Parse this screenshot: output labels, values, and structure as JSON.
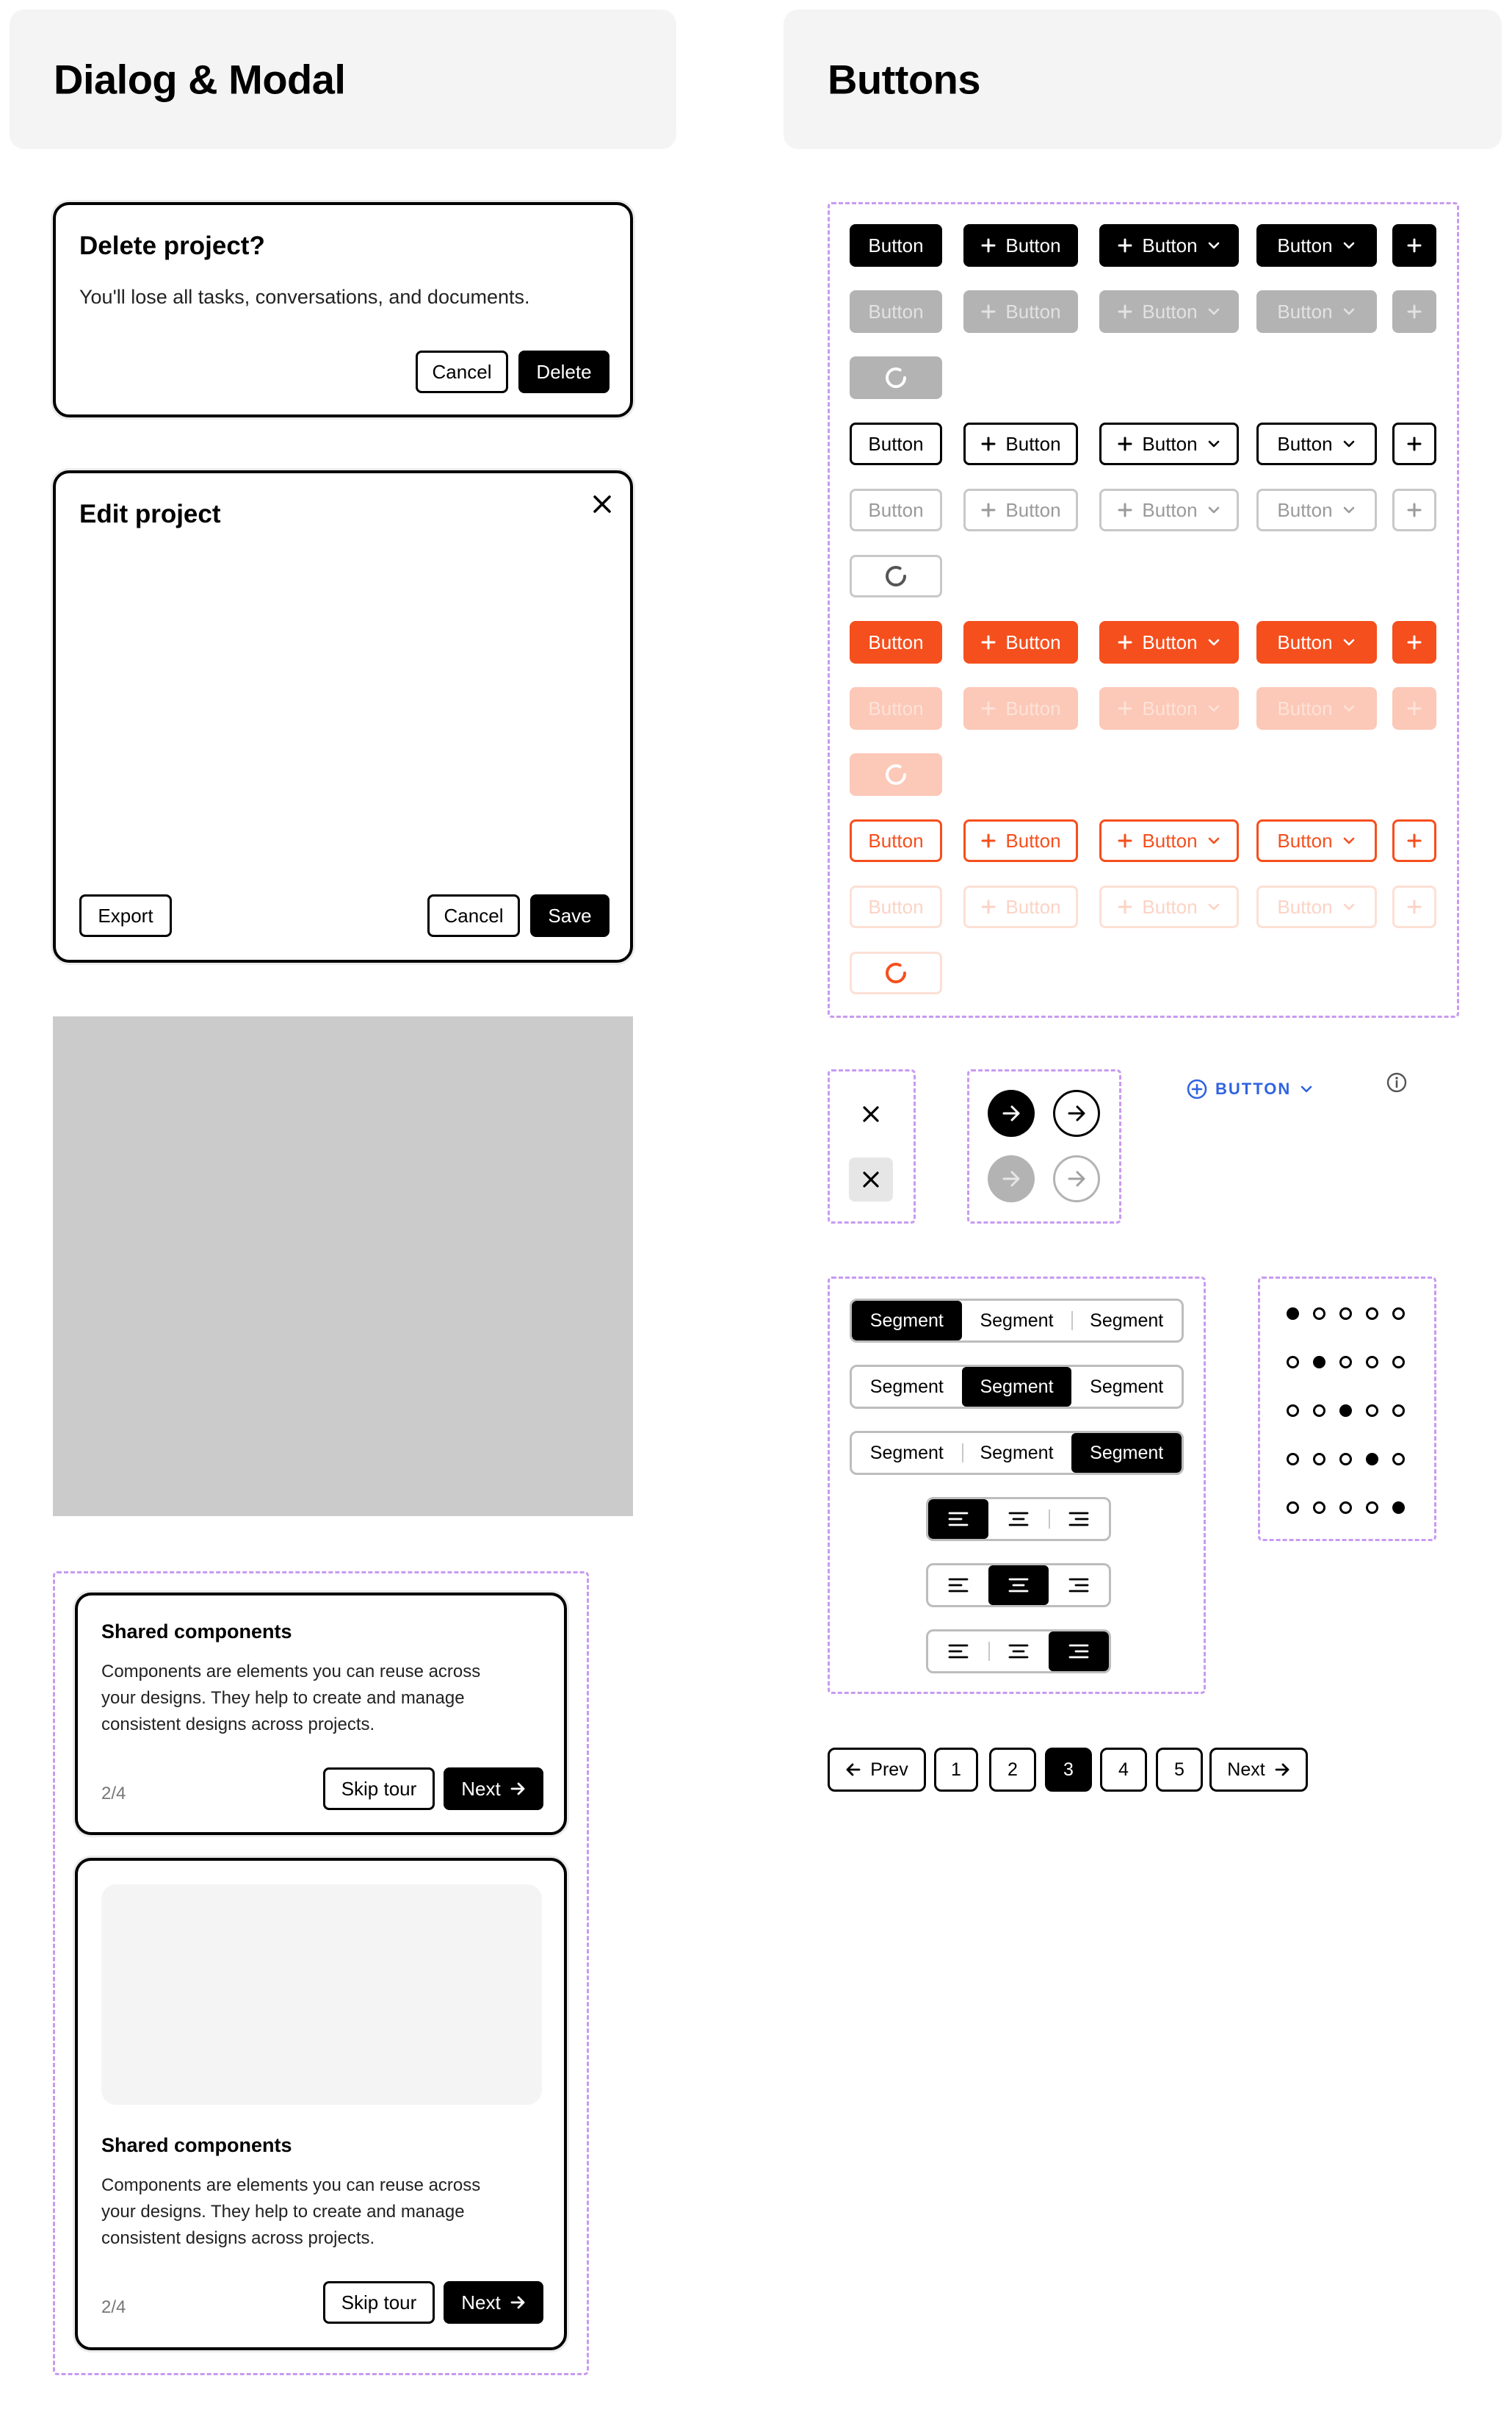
{
  "sections": {
    "dialog_title": "Dialog & Modal",
    "buttons_title": "Buttons"
  },
  "delete_dialog": {
    "title": "Delete project?",
    "body": "You'll lose all tasks, conversations, and documents.",
    "cancel": "Cancel",
    "delete": "Delete"
  },
  "edit_dialog": {
    "title": "Edit project",
    "export": "Export",
    "cancel": "Cancel",
    "save": "Save"
  },
  "tours": [
    {
      "title": "Shared components",
      "body": "Components are elements you can reuse across your designs. They help to create and manage consistent designs across projects.",
      "step": "2/4",
      "skip": "Skip tour",
      "next": "Next"
    },
    {
      "title": "Shared components",
      "body": "Components are elements you can reuse across your designs. They help to create and manage consistent designs across projects.",
      "step": "2/4",
      "skip": "Skip tour",
      "next": "Next"
    }
  ],
  "buttons": {
    "label": "Button",
    "text_button": "BUTTON"
  },
  "segments": {
    "labels": [
      "Segment",
      "Segment",
      "Segment"
    ]
  },
  "pagination": {
    "prev": "Prev",
    "next": "Next",
    "pages": [
      "1",
      "2",
      "3",
      "4",
      "5"
    ],
    "current": "3"
  },
  "colors": {
    "accent": "#f54f1e",
    "link_blue": "#2f63e0",
    "dashed_frame": "#c89af0"
  }
}
